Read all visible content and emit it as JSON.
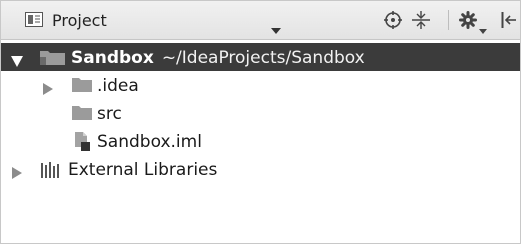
{
  "header": {
    "title": "Project",
    "icons": [
      "project-view-icon",
      "dropdown-caret-icon",
      "scroll-from-source-icon",
      "collapse-all-icon",
      "gear-icon",
      "hide-icon"
    ]
  },
  "tree": {
    "root": {
      "name": "Sandbox",
      "path": "~/IdeaProjects/Sandbox"
    },
    "items": [
      {
        "label": ".idea",
        "icon": "folder-icon"
      },
      {
        "label": "src",
        "icon": "folder-icon"
      },
      {
        "label": "Sandbox.iml",
        "icon": "module-file-icon"
      },
      {
        "label": "External Libraries",
        "icon": "libraries-icon"
      }
    ]
  },
  "colors": {
    "selection": "#3b3b3b",
    "folder": "#9b9b9b"
  }
}
